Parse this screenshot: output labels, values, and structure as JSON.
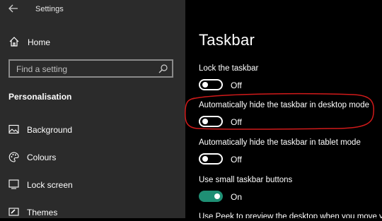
{
  "window": {
    "title": "Settings"
  },
  "sidebar": {
    "home_label": "Home",
    "search": {
      "placeholder": "Find a setting"
    },
    "section_title": "Personalisation",
    "items": [
      {
        "label": "Background",
        "icon": "background-icon"
      },
      {
        "label": "Colours",
        "icon": "palette-icon"
      },
      {
        "label": "Lock screen",
        "icon": "lock-screen-icon"
      },
      {
        "label": "Themes",
        "icon": "themes-icon"
      }
    ]
  },
  "main": {
    "title": "Taskbar",
    "settings": [
      {
        "label": "Lock the taskbar",
        "state": "Off",
        "on": false
      },
      {
        "label": "Automatically hide the taskbar in desktop mode",
        "state": "Off",
        "on": false,
        "highlighted": true
      },
      {
        "label": "Automatically hide the taskbar in tablet mode",
        "state": "Off",
        "on": false
      },
      {
        "label": "Use small taskbar buttons",
        "state": "On",
        "on": true
      },
      {
        "label": "Use Peek to preview the desktop when you move your"
      }
    ]
  },
  "colors": {
    "accent": "#1f8f74",
    "highlight_annotation": "#d11a1a",
    "sidebar_bg": "#2b2b2b",
    "main_bg": "#000000"
  }
}
